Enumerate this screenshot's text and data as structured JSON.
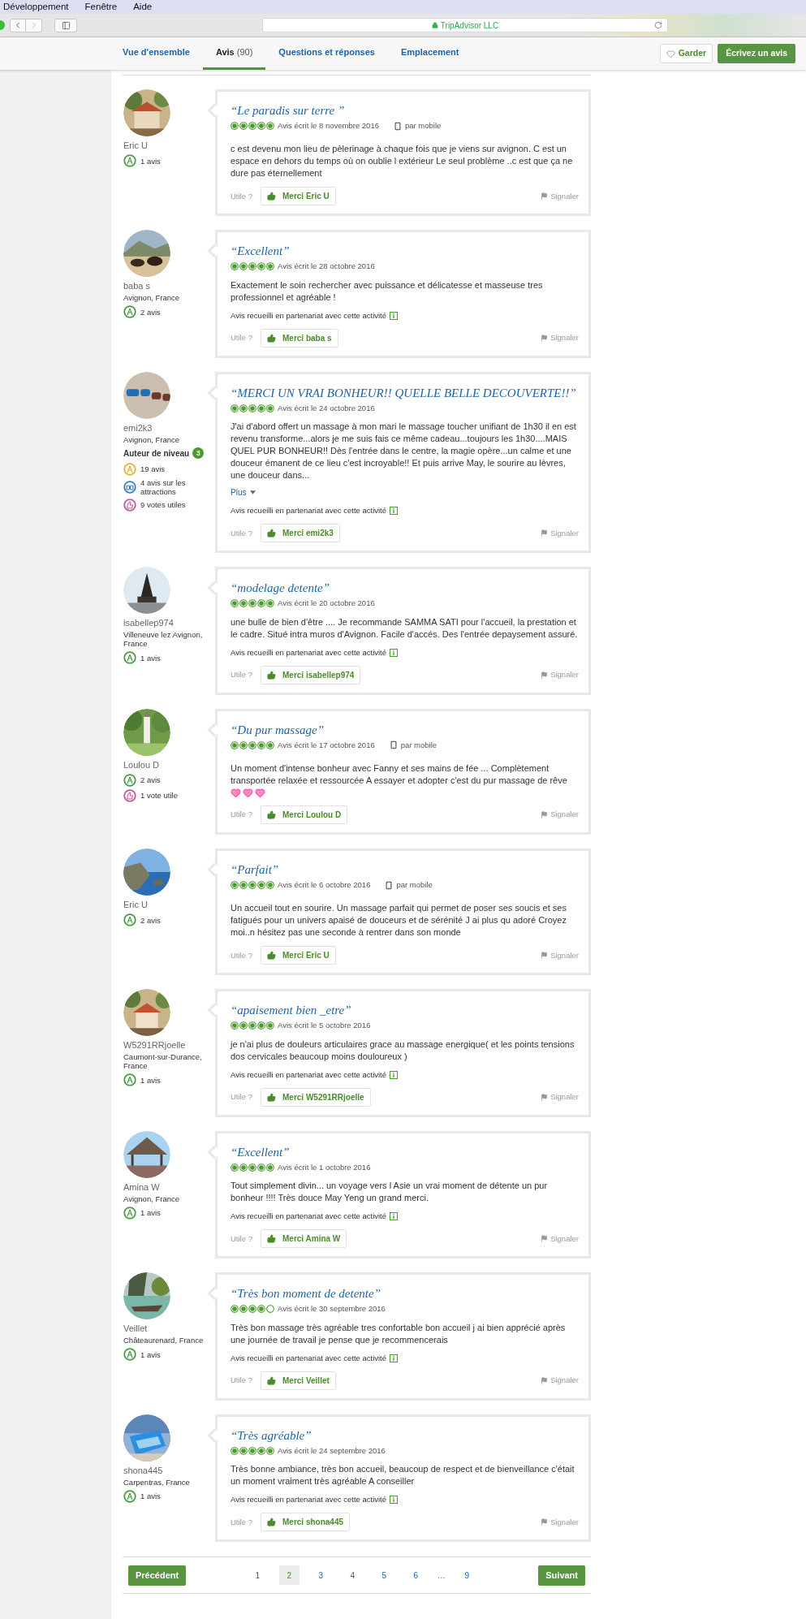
{
  "menu_bar": {
    "items": [
      "Développement",
      "Fenêtre",
      "Aide"
    ]
  },
  "browser": {
    "address": "TripAdvisor LLC",
    "secure": true
  },
  "nav": {
    "tabs": [
      {
        "label": "Vue d'ensemble",
        "selected": false
      },
      {
        "label": "Avis",
        "count": "(90)",
        "selected": true
      },
      {
        "label": "Questions et réponses",
        "selected": false
      },
      {
        "label": "Emplacement",
        "selected": false
      }
    ],
    "save_button": "Garder",
    "write_button": "Écrivez un avis"
  },
  "reviews": [
    {
      "user": {
        "name": "Eric U",
        "stats": [
          {
            "kind": "reviews",
            "text": "1 avis",
            "color": "#4a9b4a"
          }
        ]
      },
      "title": "“Le paradis sur terre ”",
      "stars": 5,
      "date": "Avis écrit le 8 novembre 2016",
      "device": "par mobile",
      "body": "c est devenu mon lieu de pèlerinage à chaque fois que je viens sur avignon. C est un espace en dehors du temps où on oublie l extérieur Le seul problème ..c est que ça ne dure pas éternellement",
      "helpful": "Utile ?",
      "thanks": "Merci Eric U",
      "report": "Signaler"
    },
    {
      "user": {
        "name": "baba s",
        "location": "Avignon, France",
        "stats": [
          {
            "kind": "reviews",
            "text": "2 avis",
            "color": "#4a9b4a"
          }
        ]
      },
      "title": "“Excellent”",
      "stars": 5,
      "date": "Avis écrit le 28 octobre 2016",
      "body": "Exactement le soin rechercher avec puissance et délicatesse et masseuse tres professionnel et agréable !",
      "partnership": "Avis recueilli en partenariat avec cette activité",
      "helpful": "Utile ?",
      "thanks": "Merci baba s",
      "report": "Signaler"
    },
    {
      "user": {
        "name": "emi2k3",
        "location": "Avignon, France",
        "level_badge": {
          "label": "Auteur de niveau",
          "number": "3"
        },
        "stats": [
          {
            "kind": "reviews",
            "text": "19 avis",
            "color": "#e0b43a"
          },
          {
            "kind": "attractions",
            "text": "4 avis sur les attractions",
            "color": "#3c7fc0"
          },
          {
            "kind": "votes",
            "text": "9 votes utiles",
            "color": "#c05a9a"
          }
        ]
      },
      "title": "“MERCI UN VRAI BONHEUR!! QUELLE BELLE DECOUVERTE!!”",
      "stars": 5,
      "date": "Avis écrit le 24 octobre 2016",
      "body": "J'ai d'abord offert un massage à mon mari le massage toucher unifiant de 1h30 il en est revenu transforme...alors je me suis fais ce même cadeau...toujours les 1h30....MAIS QUEL PUR BONHEUR!! Dès l'entrée dans le centre, la magie opère...un calme et une douceur émanent de ce lieu c'est incroyable!! Et puis arrive May, le sourire au lèvres, une douceur dans...",
      "more": "Plus",
      "partnership": "Avis recueilli en partenariat avec cette activité",
      "helpful": "Utile ?",
      "thanks": "Merci emi2k3",
      "report": "Signaler"
    },
    {
      "user": {
        "name": "isabellep974",
        "location": "Villeneuve lez Avignon, France",
        "stats": [
          {
            "kind": "reviews",
            "text": "1 avis",
            "color": "#4a9b4a"
          }
        ]
      },
      "title": "“modelage detente”",
      "stars": 5,
      "date": "Avis écrit le 20 octobre 2016",
      "body": "une bulle de bien d'être .... Je recommande SAMMA SATI pour l'accueil, la prestation et le cadre. Situé intra muros d'Avignon. Facile d'accés. Des l'entrée depaysement assuré.",
      "partnership": "Avis recueilli en partenariat avec cette activité",
      "helpful": "Utile ?",
      "thanks": "Merci isabellep974",
      "report": "Signaler"
    },
    {
      "user": {
        "name": "Loulou D",
        "stats": [
          {
            "kind": "reviews",
            "text": "2 avis",
            "color": "#4a9b4a"
          },
          {
            "kind": "votes",
            "text": "1 vote utile",
            "color": "#c05a9a"
          }
        ]
      },
      "title": "“Du pur massage”",
      "stars": 5,
      "date": "Avis écrit le 17 octobre 2016",
      "device": "par mobile",
      "body": "Un moment d'intense bonheur avec Fanny et ses mains de fée ... Complètement transportée relaxée et ressourcée A essayer et adopter c'est du pur massage de rêve",
      "reactions": [
        {
          "kind": "sparkling-heart"
        },
        {
          "kind": "sparkling-heart"
        },
        {
          "kind": "sparkling-heart"
        }
      ],
      "helpful": "Utile ?",
      "thanks": "Merci Loulou D",
      "report": "Signaler"
    },
    {
      "user": {
        "name": "Eric U",
        "stats": [
          {
            "kind": "reviews",
            "text": "2 avis",
            "color": "#4a9b4a"
          }
        ]
      },
      "title": "“Parfait”",
      "stars": 5,
      "date": "Avis écrit le 6 octobre 2016",
      "device": "par mobile",
      "body": "Un accueil tout en sourire. Un massage parfait qui permet de poser ses soucis et ses fatigués pour un univers apaisé de douceurs et de sérénité J ai plus qu adoré Croyez moi..n hésitez pas une seconde à rentrer dans son monde",
      "helpful": "Utile ?",
      "thanks": "Merci Eric U",
      "report": "Signaler"
    },
    {
      "user": {
        "name": "W5291RRjoelle",
        "location": "Caumont-sur-Durance, France",
        "stats": [
          {
            "kind": "reviews",
            "text": "1 avis",
            "color": "#4a9b4a"
          }
        ]
      },
      "title": "“apaisement bien _etre”",
      "stars": 5,
      "date": "Avis écrit le 5 octobre 2016",
      "body": "je n'ai plus de douleurs articulaires grace au massage energique( et les points tensions dos cervicales beaucoup moins douloureux )",
      "partnership": "Avis recueilli en partenariat avec cette activité",
      "helpful": "Utile ?",
      "thanks": "Merci W5291RRjoelle",
      "report": "Signaler"
    },
    {
      "user": {
        "name": "Amina W",
        "location": "Avignon, France",
        "stats": [
          {
            "kind": "reviews",
            "text": "1 avis",
            "color": "#4a9b4a"
          }
        ]
      },
      "title": "“Excellent”",
      "stars": 5,
      "date": "Avis écrit le 1 octobre 2016",
      "body": "Tout simplement divin... un voyage vers l Asie un vrai moment de détente un pur bonheur !!!! Très douce May Yeng un grand merci.",
      "partnership": "Avis recueilli en partenariat avec cette activité",
      "helpful": "Utile ?",
      "thanks": "Merci Amina W",
      "report": "Signaler"
    },
    {
      "user": {
        "name": "Veillet",
        "location": "Châteaurenard, France",
        "stats": [
          {
            "kind": "reviews",
            "text": "1 avis",
            "color": "#4a9b4a"
          }
        ]
      },
      "title": "“Très bon moment de detente”",
      "stars": 4,
      "date": "Avis écrit le 30 septembre 2016",
      "body": "Très bon massage très agréable tres confortable bon accueil j ai bien apprécié après une journée de travail je pense que je recommencerais",
      "partnership": "Avis recueilli en partenariat avec cette activité",
      "helpful": "Utile ?",
      "thanks": "Merci Veillet",
      "report": "Signaler"
    },
    {
      "user": {
        "name": "shona445",
        "location": "Carpentras, France",
        "stats": [
          {
            "kind": "reviews",
            "text": "1 avis",
            "color": "#4a9b4a"
          }
        ]
      },
      "title": "“Très agréable”",
      "stars": 5,
      "date": "Avis écrit le 24 septembre 2016",
      "body": "Très bonne ambiance, très bon accueil, beaucoup de respect et de bienveillance c'était un moment vraiment très agréable A conseiller",
      "partnership": "Avis recueilli en partenariat avec cette activité",
      "helpful": "Utile ?",
      "thanks": "Merci shona445",
      "report": "Signaler"
    }
  ],
  "pagination": {
    "previous": "Précédent",
    "next": "Suivant",
    "pages": [
      {
        "label": "1",
        "selected": false
      },
      {
        "label": "2",
        "selected": true
      },
      {
        "label": "3",
        "selected": false
      },
      {
        "label": "4",
        "selected": false
      },
      {
        "label": "5",
        "selected": false
      },
      {
        "label": "6",
        "selected": false
      }
    ],
    "ellipsis": "…",
    "last_pages": [
      {
        "label": "9",
        "selected": false
      }
    ]
  }
}
